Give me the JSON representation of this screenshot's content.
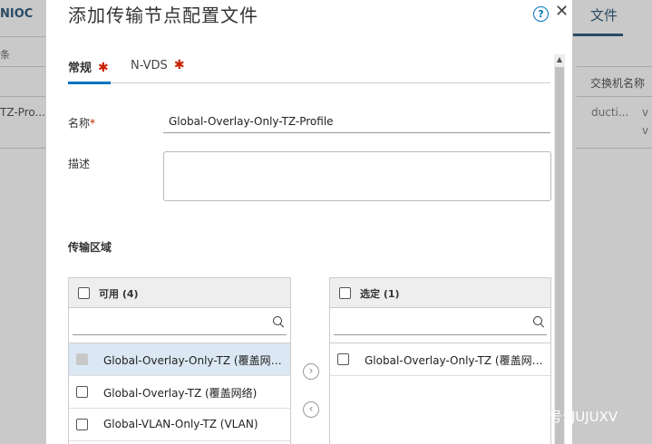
{
  "background": {
    "left_tab": "NIOC",
    "left_tab_sub": "条",
    "left_row": "TZ-Pro...",
    "right_tab": "文件",
    "right_col": "交换机名称",
    "right_cell": "ducti...",
    "right_cell2_a": "v",
    "right_cell2_b": "v"
  },
  "modal": {
    "title": "添加传输节点配置文件",
    "help_label": "?",
    "close_label": "✕",
    "tabs": [
      {
        "label": "常规",
        "required": "✱"
      },
      {
        "label": "N-VDS",
        "required": "✱"
      }
    ],
    "form": {
      "name_label": "名称",
      "name_required": "*",
      "name_value": "Global-Overlay-Only-TZ-Profile",
      "description_label": "描述",
      "description_value": ""
    },
    "transport_zones": {
      "section_title": "传输区域",
      "available": {
        "header": "可用 (4)",
        "search_placeholder": "",
        "items": [
          {
            "label": "Global-Overlay-Only-TZ (覆盖网络)",
            "state": "selected-disabled"
          },
          {
            "label": "Global-Overlay-TZ (覆盖网络)",
            "state": "unchecked"
          },
          {
            "label": "Global-VLAN-Only-TZ (VLAN)",
            "state": "unchecked"
          }
        ]
      },
      "selected": {
        "header": "选定 (1)",
        "search_placeholder": "",
        "items": [
          {
            "label": "Global-Overlay-Only-TZ (覆盖网络)",
            "state": "unchecked"
          }
        ]
      },
      "move_right_icon": "›",
      "move_left_icon": "‹"
    }
  },
  "watermark": {
    "text": "微信号: JUJUXV"
  },
  "colors": {
    "accent": "#0073c0",
    "required": "#c92100",
    "selected_row": "#dbe8f3"
  }
}
